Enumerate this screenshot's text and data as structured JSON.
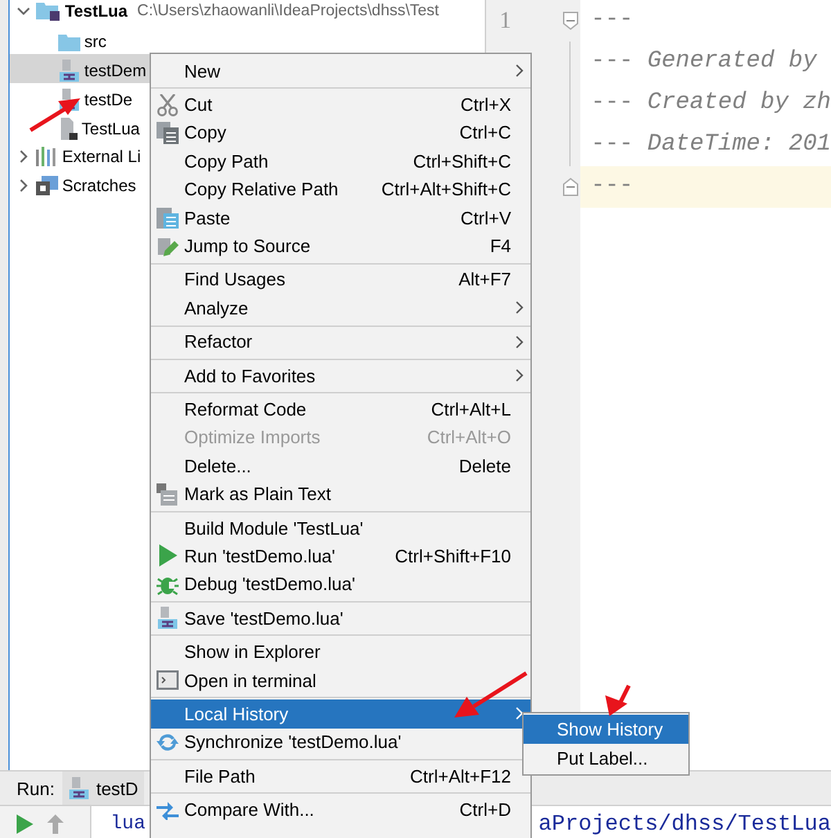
{
  "project_tree": {
    "items": [
      {
        "label": "TestLua",
        "path": "C:\\Users\\zhaowanli\\IdeaProjects\\dhss\\Test",
        "kind": "module",
        "expanded": true,
        "selected": false,
        "children": [
          {
            "label": "src",
            "kind": "folder",
            "selected": false
          },
          {
            "label": "testDem",
            "kind": "lua",
            "selected": true
          },
          {
            "label": "testDe",
            "kind": "lua",
            "selected": false
          },
          {
            "label": "TestLua",
            "kind": "file",
            "selected": false
          }
        ]
      },
      {
        "label": "External Li",
        "kind": "library",
        "expanded": false,
        "selected": false
      },
      {
        "label": "Scratches",
        "kind": "scratch",
        "expanded": false,
        "selected": false
      }
    ]
  },
  "editor": {
    "line_numbers": [
      "1"
    ],
    "lines": [
      {
        "text": "---",
        "highlighted": false,
        "fold": true
      },
      {
        "text": "--- *Generated by*",
        "highlighted": false,
        "fold": false
      },
      {
        "text": "--- *Created by zh*",
        "highlighted": false,
        "fold": false
      },
      {
        "text": "--- *DateTime: 201*",
        "highlighted": false,
        "fold": false
      },
      {
        "text": "---",
        "highlighted": true,
        "fold": true
      }
    ]
  },
  "run_panel": {
    "label": "Run:",
    "tab": "testD",
    "console": [
      "lua",
      "aProjects/dhss/TestLua"
    ]
  },
  "context_menu": {
    "items": [
      {
        "kind": "plain",
        "label": "New",
        "submenu": true,
        "disabled": false,
        "selected": false
      },
      {
        "kind": "separator"
      },
      {
        "kind": "scissors",
        "label": "Cut",
        "shortcut": "Ctrl+X",
        "submenu": false,
        "disabled": false,
        "selected": false
      },
      {
        "kind": "copy",
        "label": "Copy",
        "shortcut": "Ctrl+C",
        "submenu": false,
        "disabled": false,
        "selected": false
      },
      {
        "kind": "plain",
        "label": "Copy Path",
        "shortcut": "Ctrl+Shift+C",
        "submenu": false,
        "disabled": false,
        "selected": false
      },
      {
        "kind": "plain",
        "label": "Copy Relative Path",
        "shortcut": "Ctrl+Alt+Shift+C",
        "submenu": false,
        "disabled": false,
        "selected": false
      },
      {
        "kind": "paste",
        "label": "Paste",
        "shortcut": "Ctrl+V",
        "submenu": false,
        "disabled": false,
        "selected": false
      },
      {
        "kind": "pencil",
        "label": "Jump to Source",
        "shortcut": "F4",
        "submenu": false,
        "disabled": false,
        "selected": false
      },
      {
        "kind": "separator"
      },
      {
        "kind": "plain",
        "label": "Find Usages",
        "shortcut": "Alt+F7",
        "submenu": false,
        "disabled": false,
        "selected": false
      },
      {
        "kind": "plain",
        "label": "Analyze",
        "submenu": true,
        "disabled": false,
        "selected": false
      },
      {
        "kind": "separator"
      },
      {
        "kind": "plain",
        "label": "Refactor",
        "submenu": true,
        "disabled": false,
        "selected": false
      },
      {
        "kind": "separator"
      },
      {
        "kind": "plain",
        "label": "Add to Favorites",
        "submenu": true,
        "disabled": false,
        "selected": false
      },
      {
        "kind": "separator"
      },
      {
        "kind": "plain",
        "label": "Reformat Code",
        "shortcut": "Ctrl+Alt+L",
        "submenu": false,
        "disabled": false,
        "selected": false
      },
      {
        "kind": "plain",
        "label": "Optimize Imports",
        "shortcut": "Ctrl+Alt+O",
        "submenu": false,
        "disabled": true,
        "selected": false
      },
      {
        "kind": "plain",
        "label": "Delete...",
        "shortcut": "Delete",
        "submenu": false,
        "disabled": false,
        "selected": false
      },
      {
        "kind": "plaintext",
        "label": "Mark as Plain Text",
        "submenu": false,
        "disabled": false,
        "selected": false
      },
      {
        "kind": "separator"
      },
      {
        "kind": "plain",
        "label": "Build Module 'TestLua'",
        "submenu": false,
        "disabled": false,
        "selected": false
      },
      {
        "kind": "run",
        "label": "Run 'testDemo.lua'",
        "shortcut": "Ctrl+Shift+F10",
        "submenu": false,
        "disabled": false,
        "selected": false
      },
      {
        "kind": "bug",
        "label": "Debug 'testDemo.lua'",
        "submenu": false,
        "disabled": false,
        "selected": false
      },
      {
        "kind": "separator"
      },
      {
        "kind": "lua",
        "label": "Save 'testDemo.lua'",
        "submenu": false,
        "disabled": false,
        "selected": false
      },
      {
        "kind": "separator"
      },
      {
        "kind": "plain",
        "label": "Show in Explorer",
        "submenu": false,
        "disabled": false,
        "selected": false
      },
      {
        "kind": "terminal",
        "label": "Open in terminal",
        "submenu": false,
        "disabled": false,
        "selected": false
      },
      {
        "kind": "separator"
      },
      {
        "kind": "plain",
        "label": "Local History",
        "submenu": true,
        "disabled": false,
        "selected": true
      },
      {
        "kind": "sync",
        "label": "Synchronize 'testDemo.lua'",
        "submenu": false,
        "disabled": false,
        "selected": false
      },
      {
        "kind": "separator"
      },
      {
        "kind": "plain",
        "label": "File Path",
        "shortcut": "Ctrl+Alt+F12",
        "submenu": false,
        "disabled": false,
        "selected": false
      },
      {
        "kind": "separator"
      },
      {
        "kind": "compare",
        "label": "Compare With...",
        "shortcut": "Ctrl+D",
        "submenu": false,
        "disabled": false,
        "selected": false
      }
    ]
  },
  "submenu": {
    "items": [
      {
        "label": "Show History",
        "selected": true
      },
      {
        "label": "Put Label...",
        "selected": false
      }
    ]
  }
}
